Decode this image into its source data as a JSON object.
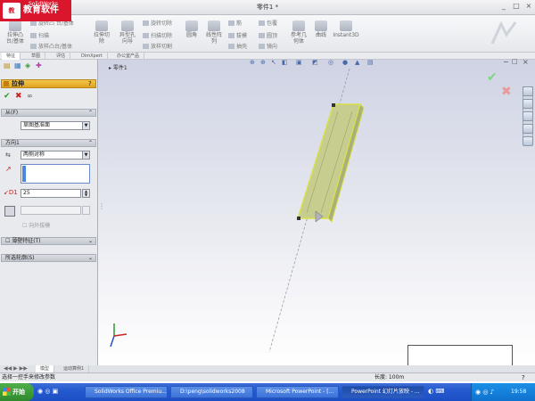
{
  "app": {
    "logo_text": "教育软件",
    "logo_mark": "教",
    "window_title_app": "SolidWorks",
    "document_title": "零件1 *",
    "window_controls": [
      "_",
      "□",
      "×"
    ]
  },
  "ribbon": {
    "buttons": [
      {
        "label": "拉伸凸\n台/基体"
      },
      {
        "label": "旋转凸\n台/基体"
      },
      {
        "label": "拉伸切\n除"
      },
      {
        "label": "异型孔\n向导"
      },
      {
        "label": "圆角"
      },
      {
        "label": "线性阵\n列"
      },
      {
        "label": "参考几\n何体"
      },
      {
        "label": "曲线"
      },
      {
        "label": "Instant3D"
      }
    ],
    "small_items": [
      "扫描",
      "放样凸台/基体",
      "扫描切除",
      "放样切割",
      "旋转切除",
      "筋",
      "包覆",
      "拔模",
      "圆顶",
      "抽壳",
      "镜向"
    ]
  },
  "tabs": [
    "特征",
    "草图",
    "评估",
    "DimXpert",
    "办公室产品"
  ],
  "panel": {
    "title": "拉伸",
    "help_icon": "?",
    "from": {
      "title": "从(F)",
      "value": "草图基准面"
    },
    "direction1": {
      "title": "方向1",
      "end_condition": "两侧对称",
      "depth": "25",
      "draft_outward": "向外拔模"
    },
    "thin_feature": {
      "title": "薄壁特征(T)"
    },
    "selected_contours": {
      "title": "所选轮廓(S)"
    }
  },
  "graphics": {
    "tree_label": "零件1"
  },
  "bottom_tabs": [
    "模型",
    "运动算例1"
  ],
  "status": {
    "message": "选择一控手来修改参数",
    "length": "长度: 100m"
  },
  "taskbar": {
    "start": "开始",
    "items": [
      "SolidWorks Office Premiu...",
      "D:\\peng\\solidworks2008",
      "Microsoft PowerPoint - [...",
      "PowerPoint 幻灯片放映 - ..."
    ],
    "clock": "19:58"
  },
  "colors": {
    "accent_green": "#1fa31f",
    "accent_red": "#d9162b",
    "model_highlight": "#c8d44a",
    "taskbar_blue": "#245ad0"
  }
}
